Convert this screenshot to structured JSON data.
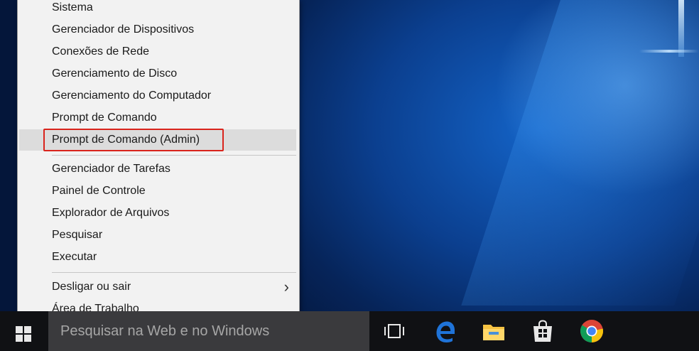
{
  "menu": {
    "items": [
      {
        "label": "Sistema"
      },
      {
        "label": "Gerenciador de Dispositivos"
      },
      {
        "label": "Conexões de Rede"
      },
      {
        "label": "Gerenciamento de Disco"
      },
      {
        "label": "Gerenciamento do Computador"
      },
      {
        "label": "Prompt de Comando"
      },
      {
        "label": "Prompt de Comando (Admin)"
      },
      {
        "label": "Gerenciador de Tarefas"
      },
      {
        "label": "Painel de Controle"
      },
      {
        "label": "Explorador de Arquivos"
      },
      {
        "label": "Pesquisar"
      },
      {
        "label": "Executar"
      },
      {
        "label": "Desligar ou sair"
      },
      {
        "label": "Área de Trabalho"
      }
    ],
    "highlighted_item": "Prompt de Comando (Admin)",
    "highlight_color": "#d9241c"
  },
  "taskbar": {
    "search_placeholder": "Pesquisar na Web e no Windows",
    "icons": [
      "windows-start-icon",
      "task-view-icon",
      "edge-icon",
      "file-explorer-icon",
      "store-icon",
      "chrome-icon"
    ]
  },
  "colors": {
    "desktop_blue": "#0b3f8f",
    "taskbar": "#101114",
    "edge_blue": "#1f73d8",
    "folder_yellow": "#f5c242"
  }
}
